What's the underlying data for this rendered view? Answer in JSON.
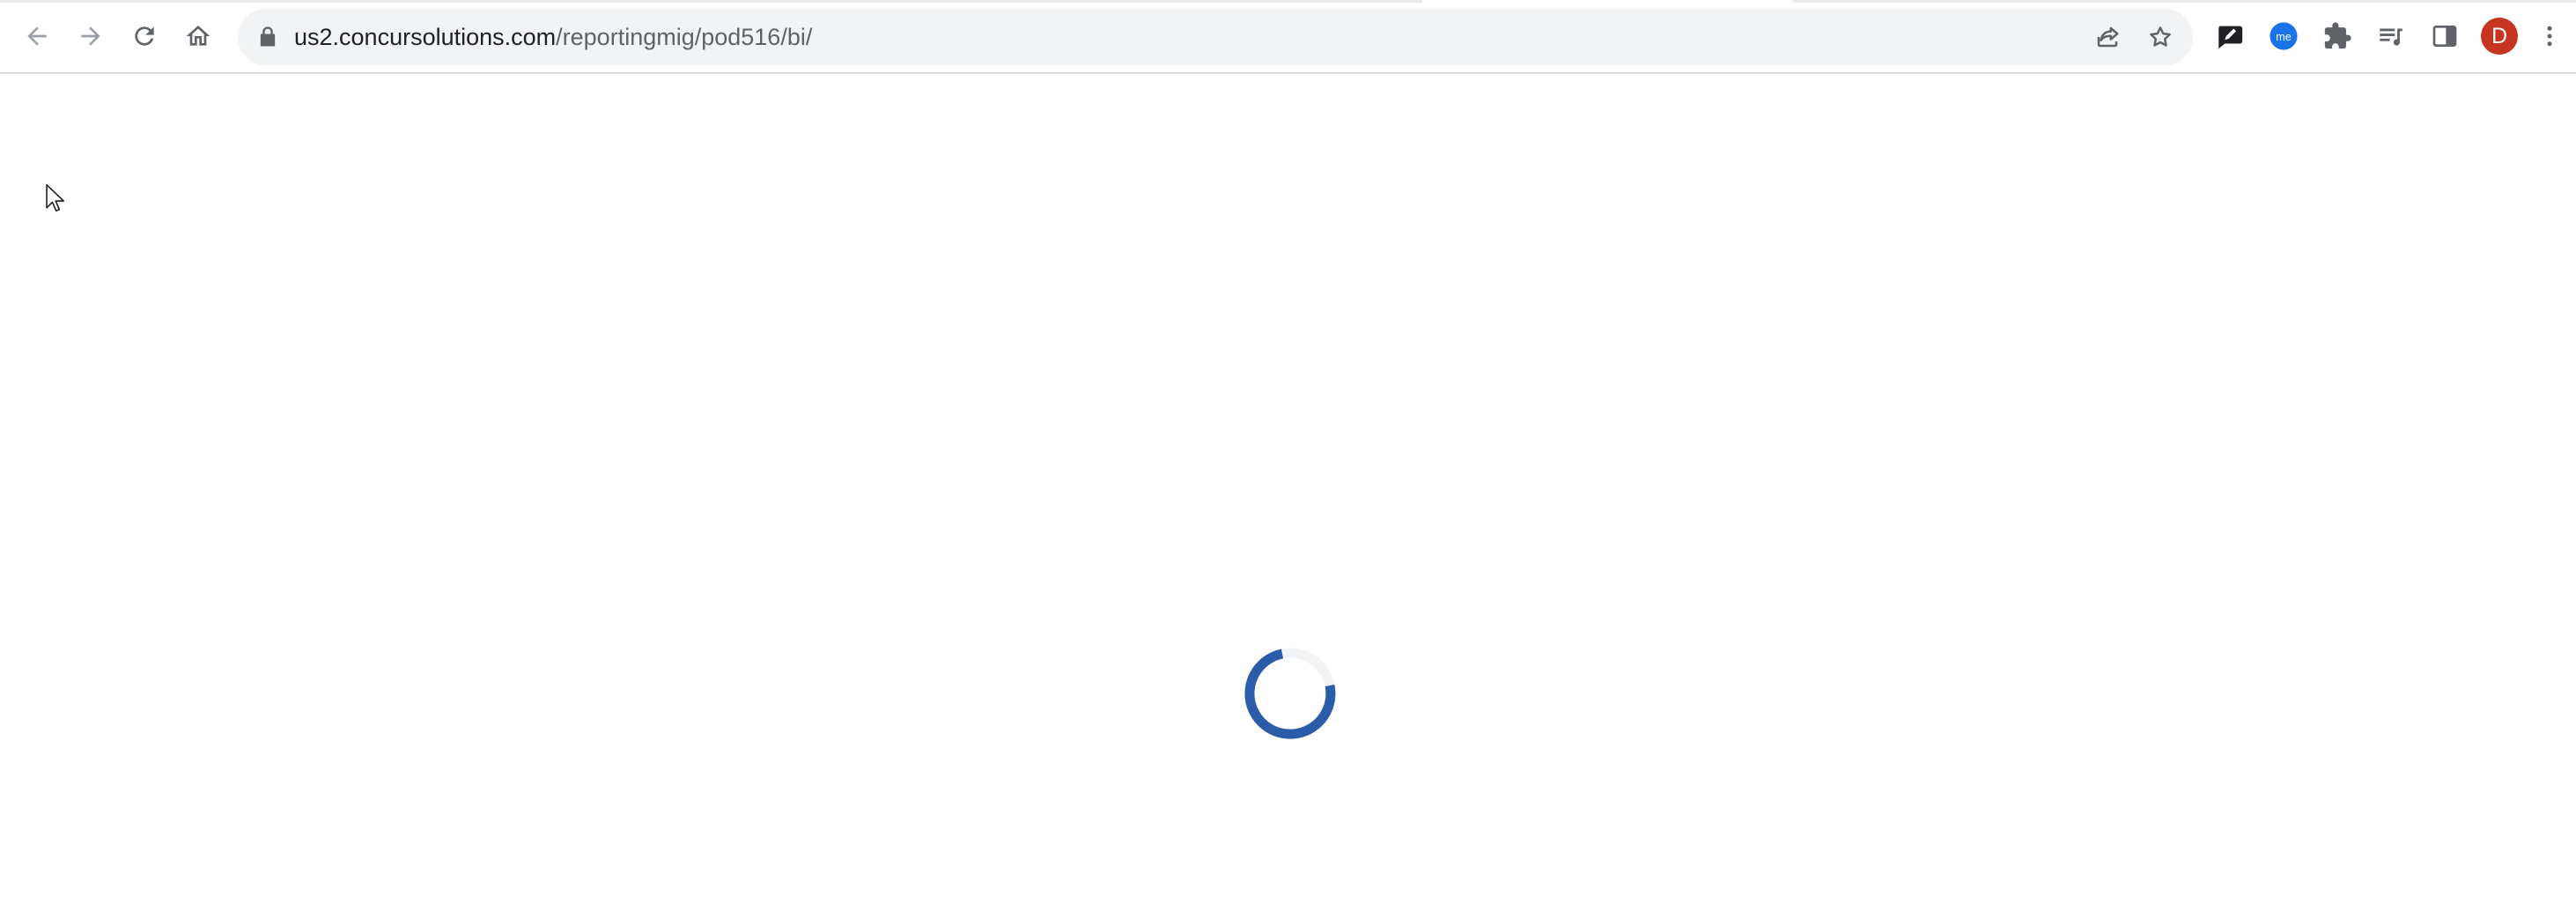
{
  "browser": {
    "url_host": "us2.concursolutions.com",
    "url_path": "/reportingmig/pod516/bi/",
    "profile_initial": "D",
    "extension_badge": "me",
    "colors": {
      "accent_spinner": "#2a5caa",
      "avatar": "#c5351f",
      "extension_me": "#1a73e8"
    }
  },
  "page": {
    "state": "loading",
    "spinner_icon": "loading-spinner-icon",
    "cursor_icon": "mouse-pointer-icon"
  }
}
